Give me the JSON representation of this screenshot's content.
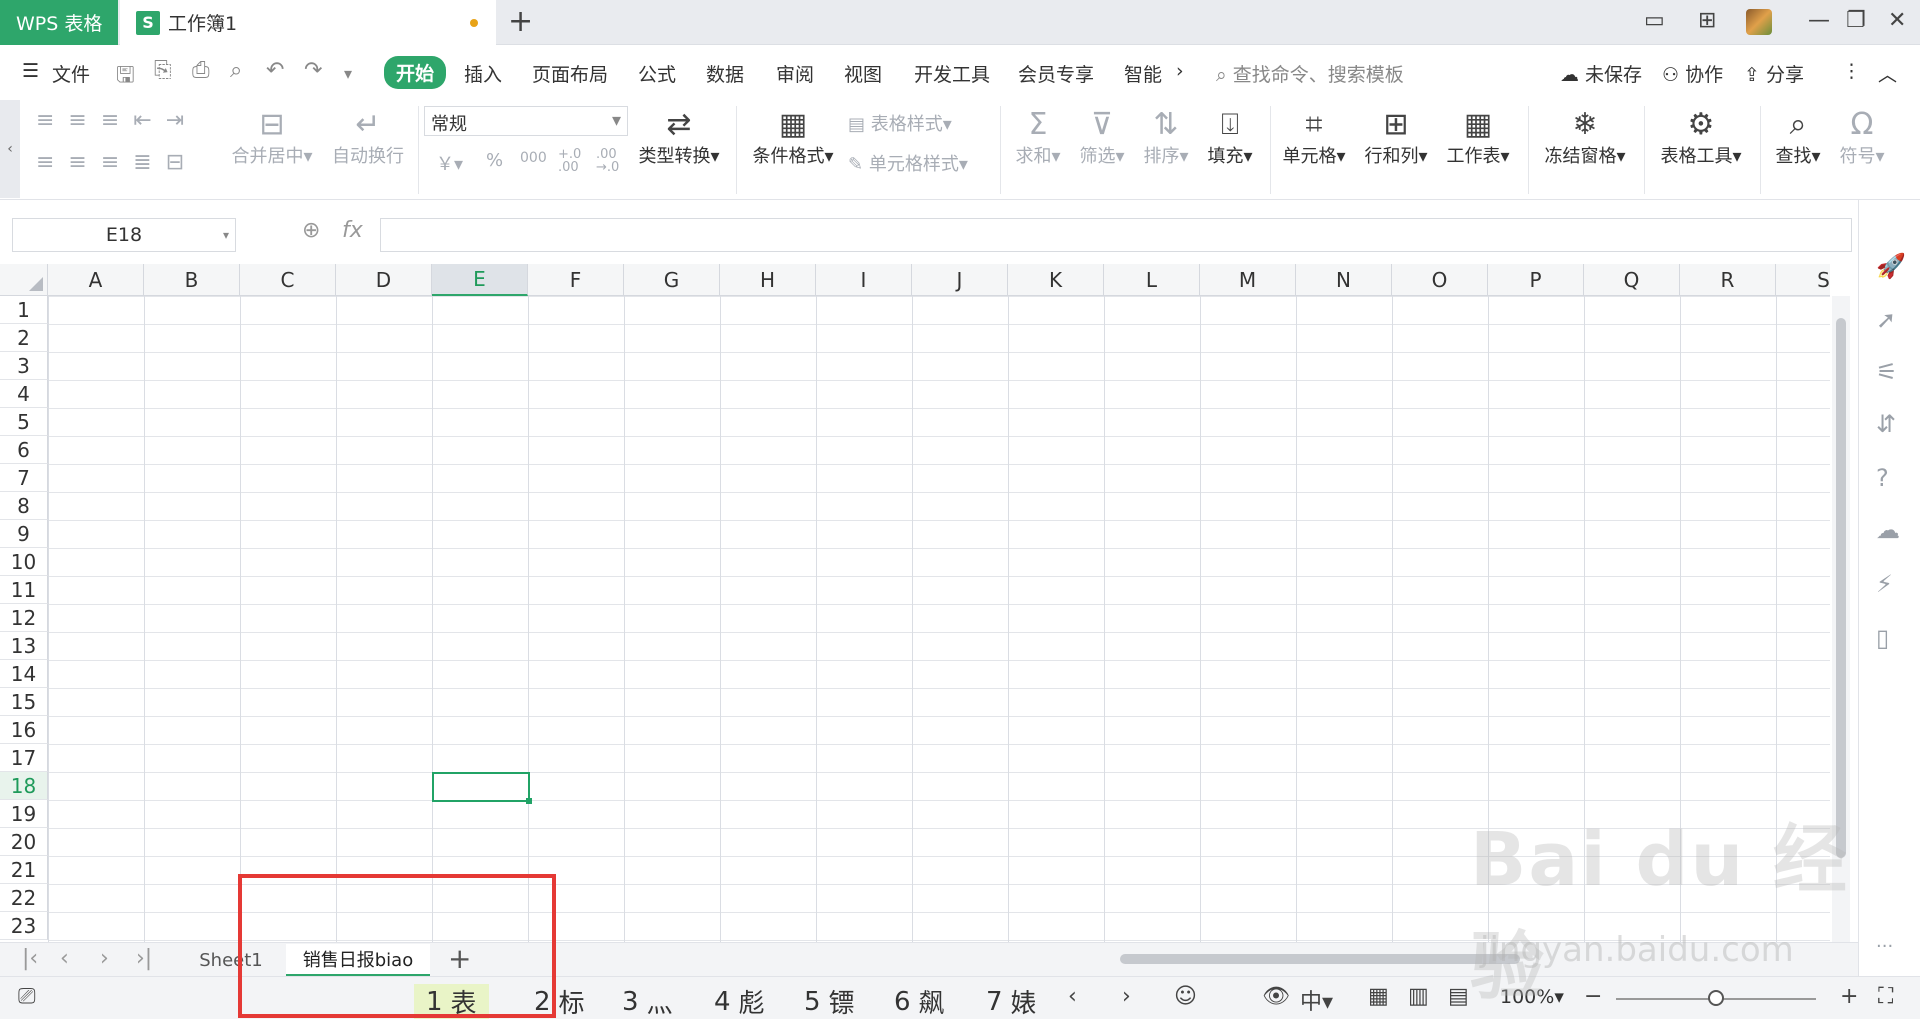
{
  "tabs": {
    "app_label": "WPS 表格",
    "doc_icon": "S",
    "doc_title": "工作簿1",
    "new_tab": "+"
  },
  "titlebar_icons": [
    "window-layout-icon",
    "apps-grid-icon",
    "avatar",
    "minimize-icon",
    "restore-icon",
    "close-icon"
  ],
  "menu": {
    "file": "文件",
    "items": [
      "开始",
      "插入",
      "页面布局",
      "公式",
      "数据",
      "审阅",
      "视图",
      "开发工具",
      "会员专享",
      "智能"
    ],
    "active": "开始",
    "more": "›",
    "search_placeholder": "查找命令、搜索模板",
    "unsaved": "未保存",
    "collab": "协作",
    "share": "分享"
  },
  "ribbon": {
    "merge": "合并居中",
    "wrap": "自动换行",
    "number_format": "常规",
    "currency": "￥",
    "percent": "%",
    "thousands": "000",
    "inc_decimal": "+.0 .00",
    "dec_decimal": ".00 →.0",
    "type_convert": "类型转换",
    "cond_format": "条件格式",
    "table_style": "表格样式",
    "cell_style": "单元格样式",
    "sum": "求和",
    "filter": "筛选",
    "sort": "排序",
    "fill": "填充",
    "cell": "单元格",
    "rowcol": "行和列",
    "sheet": "工作表",
    "freeze": "冻结窗格",
    "table_tools": "表格工具",
    "find": "查找",
    "symbol": "符号"
  },
  "formula_bar": {
    "name_box": "E18",
    "fx": "fx",
    "value": ""
  },
  "grid": {
    "columns": [
      "A",
      "B",
      "C",
      "D",
      "E",
      "F",
      "G",
      "H",
      "I",
      "J",
      "K",
      "L",
      "M",
      "N",
      "O",
      "P",
      "Q",
      "R",
      "S"
    ],
    "rows": [
      "1",
      "2",
      "3",
      "4",
      "5",
      "6",
      "7",
      "8",
      "9",
      "10",
      "11",
      "12",
      "13",
      "14",
      "15",
      "16",
      "17",
      "18",
      "19",
      "20",
      "21",
      "22",
      "23"
    ],
    "selected_column": "E",
    "selected_row": "18"
  },
  "sheets": {
    "tabs": [
      "Sheet1",
      "销售日报biao"
    ],
    "active": "销售日报biao",
    "add": "+"
  },
  "ime_candidates": [
    {
      "num": "1",
      "text": "表"
    },
    {
      "num": "2",
      "text": "标"
    },
    {
      "num": "3",
      "text": "灬"
    },
    {
      "num": "4",
      "text": "彪"
    },
    {
      "num": "5",
      "text": "镖"
    },
    {
      "num": "6",
      "text": "飙"
    },
    {
      "num": "7",
      "text": "婊"
    }
  ],
  "status": {
    "zoom": "100%"
  },
  "watermark": {
    "brand": "Bai du 经验",
    "url": "jingyan.baidu.com"
  },
  "colors": {
    "accent": "#2ea66b",
    "selection": "#21a366",
    "annotation_box": "#e53935"
  }
}
